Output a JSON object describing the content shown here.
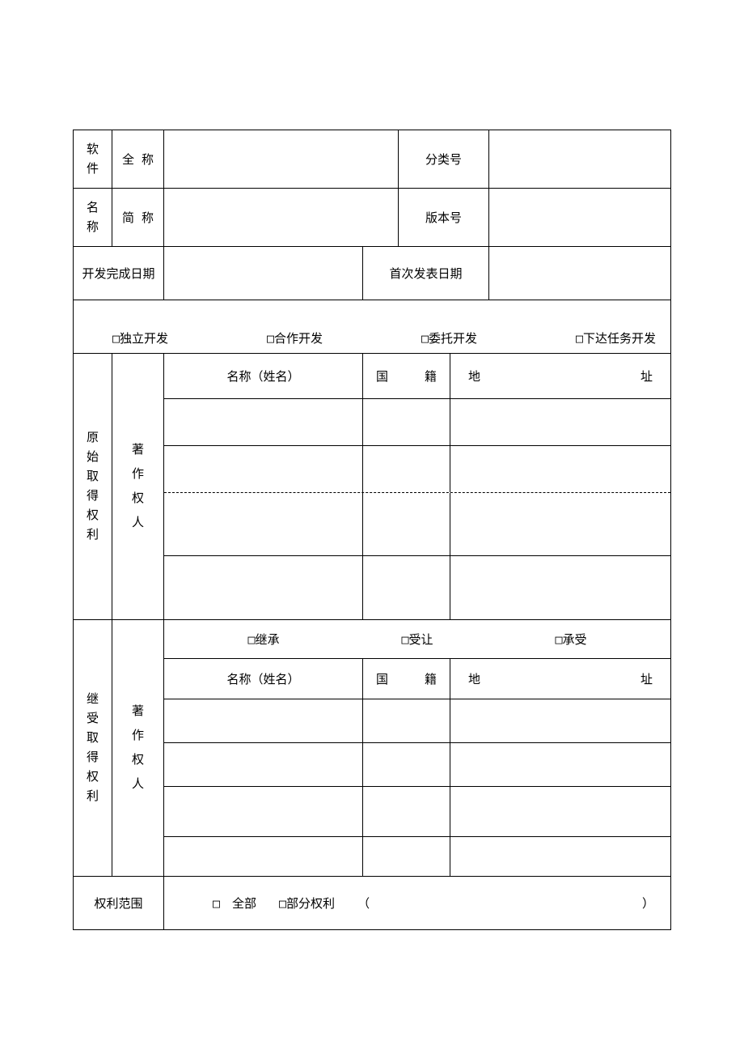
{
  "software_name": {
    "label_group": "软件名称",
    "full_label": "全称",
    "short_label": "简称",
    "full_value": "",
    "short_value": "",
    "class_no_label": "分类号",
    "class_no_value": "",
    "version_label": "版本号",
    "version_value": ""
  },
  "dates": {
    "dev_complete_label": "开发完成日期",
    "dev_complete_value": "",
    "first_publish_label": "首次发表日期",
    "first_publish_value": ""
  },
  "dev_mode": {
    "independent": "□独立开发",
    "cooperative": "□合作开发",
    "entrusted": "□委托开发",
    "assigned": "□下达任务开发"
  },
  "original": {
    "section_label": "原始取得权利",
    "holder_label": "著作权人",
    "col_name": "名称（姓名）",
    "col_nationality_a": "国",
    "col_nationality_b": "籍",
    "col_address_a": "地",
    "col_address_b": "址",
    "rows": [
      {
        "name": "",
        "nationality": "",
        "address": ""
      },
      {
        "name": "",
        "nationality": "",
        "address": ""
      },
      {
        "name": "",
        "nationality": "",
        "address": ""
      },
      {
        "name": "",
        "nationality": "",
        "address": ""
      }
    ]
  },
  "successor": {
    "section_label": "继受取得权利",
    "holder_label": "著作权人",
    "type_inherit": "□继承",
    "type_transfer": "□受让",
    "type_bear": "□承受",
    "col_name": "名称（姓名）",
    "col_nationality_a": "国",
    "col_nationality_b": "籍",
    "col_address_a": "地",
    "col_address_b": "址",
    "rows": [
      {
        "name": "",
        "nationality": "",
        "address": ""
      },
      {
        "name": "",
        "nationality": "",
        "address": ""
      },
      {
        "name": "",
        "nationality": "",
        "address": ""
      },
      {
        "name": "",
        "nationality": "",
        "address": ""
      }
    ]
  },
  "scope": {
    "label": "权利范围",
    "all": "□　全部",
    "partial": "□部分权利",
    "paren_open": "（",
    "paren_close": "）",
    "detail": ""
  }
}
